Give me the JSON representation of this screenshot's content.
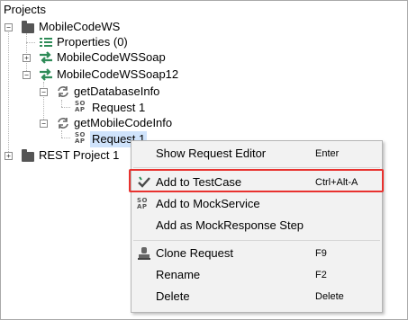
{
  "panel": {
    "title": "Projects"
  },
  "tree": {
    "workspace": "MobileCodeWS",
    "properties": "Properties (0)",
    "soap11": "MobileCodeWSSoap",
    "soap12": "MobileCodeWSSoap12",
    "op1": "getDatabaseInfo",
    "op1_request": "Request 1",
    "op2": "getMobileCodeInfo",
    "op2_request": "Request 1",
    "rest_project": "REST Project 1",
    "soap_icon_top": "SO",
    "soap_icon_bottom": "AP"
  },
  "context_menu": {
    "show_editor": {
      "label": "Show Request Editor",
      "shortcut": "Enter"
    },
    "add_testcase": {
      "label": "Add to TestCase",
      "shortcut": "Ctrl+Alt-A"
    },
    "add_mockservice": {
      "label": "Add to MockService",
      "shortcut": ""
    },
    "add_mockresponse": {
      "label": "Add as MockResponse Step",
      "shortcut": ""
    },
    "clone": {
      "label": "Clone Request",
      "shortcut": "F9"
    },
    "rename": {
      "label": "Rename",
      "shortcut": "F2"
    },
    "delete": {
      "label": "Delete",
      "shortcut": "Delete"
    }
  },
  "colors": {
    "highlight_border": "#e8322f",
    "selection": "#cfe3fb",
    "icon_green": "#2e8b57"
  }
}
